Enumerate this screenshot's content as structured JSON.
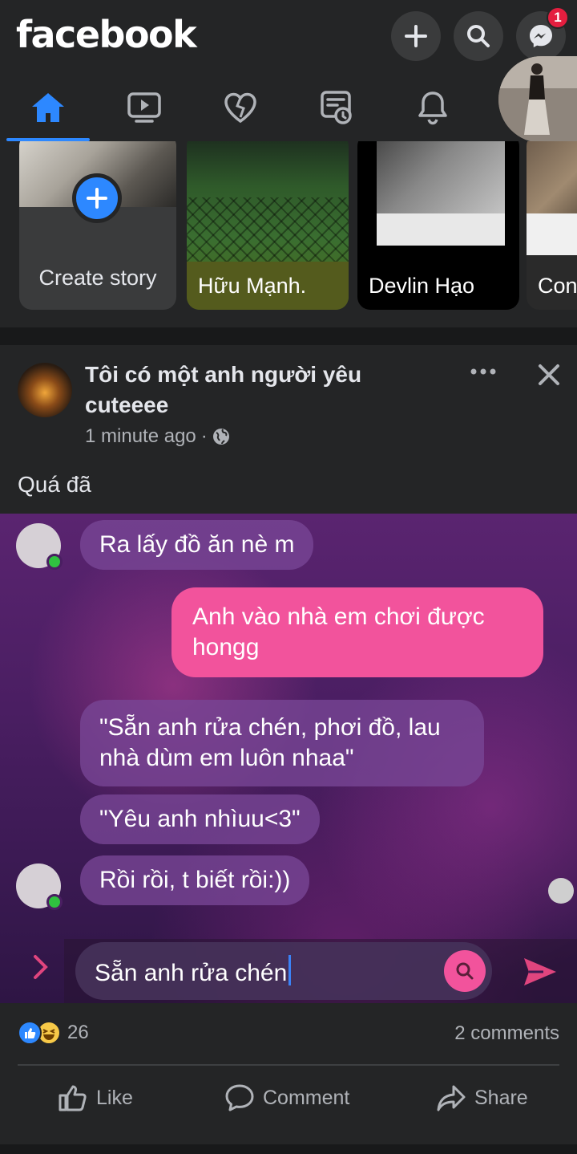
{
  "header": {
    "logo": "facebook",
    "messenger_badge": "1"
  },
  "tabs": [
    {
      "name": "home",
      "active": true
    },
    {
      "name": "watch",
      "active": false
    },
    {
      "name": "dating",
      "active": false
    },
    {
      "name": "feeds",
      "active": false
    },
    {
      "name": "notifications",
      "active": false
    }
  ],
  "stories": {
    "create_label": "Create story",
    "items": [
      {
        "name": "Hữu Mạnh."
      },
      {
        "name": "Devlin Hạo"
      },
      {
        "name": "Con"
      }
    ]
  },
  "post": {
    "author": "Tôi có một anh người yêu cuteeee",
    "time": "1 minute ago",
    "separator": "·",
    "caption": "Quá đã",
    "chat": {
      "msg1": "Ra lấy đồ ăn nè m",
      "msg2": "Anh vào nhà em chơi được hongg",
      "msg3": "\"Sẵn anh rửa chén, phơi đồ, lau nhà dùm em luôn nhaa\"",
      "msg4": "\"Yêu anh nhìuu<3\"",
      "msg5": "Rồi rồi, t biết rồi:))",
      "input_text": "Sẵn anh rửa chén"
    },
    "reaction_count": "26",
    "comments": "2 comments",
    "actions": {
      "like": "Like",
      "comment": "Comment",
      "share": "Share"
    }
  },
  "colors": {
    "accent": "#2d88ff",
    "background": "#18191a",
    "surface": "#242526",
    "bubble_out": "#f2539c",
    "badge": "#e41e3f"
  }
}
